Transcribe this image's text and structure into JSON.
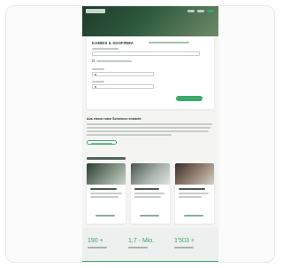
{
  "form": {
    "title": "KAMIDS & SOOFIRMA"
  },
  "section": {
    "heading": "Aus einem roten Schreinen entsteht"
  },
  "stats": [
    {
      "value": "190 +"
    },
    {
      "value": "1,7 - Mio."
    },
    {
      "value": "1'503 +"
    }
  ],
  "colors": {
    "accent": "#3ea96b",
    "hero_dark": "#1f3a2a"
  }
}
